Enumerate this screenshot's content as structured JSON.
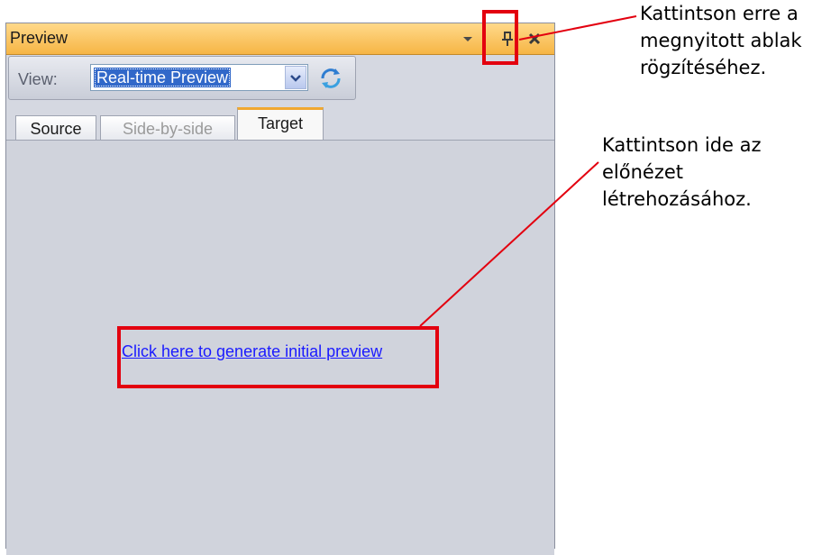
{
  "panel": {
    "title": "Preview",
    "dropdown_icon": "chevron-down-icon",
    "pin_icon": "pin-icon",
    "close_icon": "close-icon"
  },
  "toolbar": {
    "view_label": "View:",
    "view_value": "Real-time Preview",
    "refresh_icon": "refresh-icon"
  },
  "tabs": [
    {
      "label": "Source",
      "state": "normal"
    },
    {
      "label": "Side-by-side",
      "state": "disabled"
    },
    {
      "label": "Target",
      "state": "active"
    }
  ],
  "content": {
    "link_text": "Click here to generate initial preview"
  },
  "annotations": {
    "pin": [
      "Kattintson erre a",
      "megnyitott ablak",
      "rögzítéséhez."
    ],
    "link": [
      "Kattintson ide az",
      "előnézet",
      "létrehozásához."
    ]
  },
  "colors": {
    "title_bar": "#f6b545",
    "panel_bg": "#d5d8e1",
    "highlight": "#e3000f",
    "link": "#1a1aff",
    "selection": "#3168c9"
  }
}
